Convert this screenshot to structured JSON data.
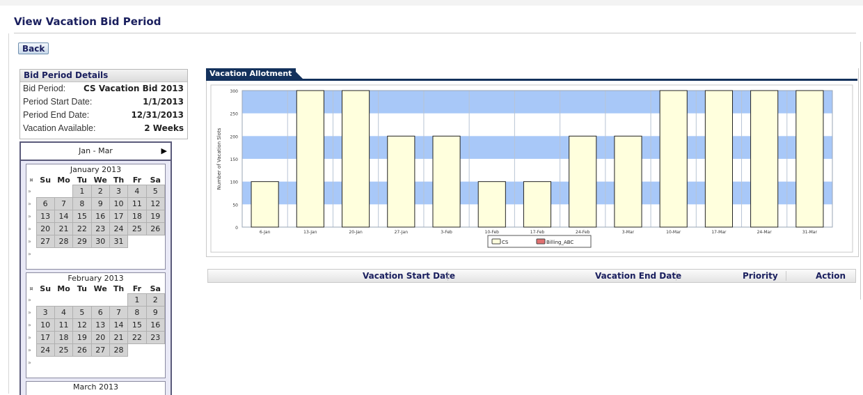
{
  "page": {
    "title": "View Vacation Bid Period",
    "back_label": "Back"
  },
  "details": {
    "heading": "Bid Period Details",
    "rows": [
      {
        "label": "Bid Period:",
        "value": "CS Vacation Bid 2013"
      },
      {
        "label": "Period Start Date:",
        "value": "1/1/2013"
      },
      {
        "label": "Period End Date:",
        "value": "12/31/2013"
      },
      {
        "label": "Vacation Available:",
        "value": "2 Weeks"
      }
    ]
  },
  "calendar": {
    "range_label": "Jan - Mar",
    "next_icon": "triangle-right-icon",
    "week_marker": "»",
    "weekdays": [
      "Su",
      "Mo",
      "Tu",
      "We",
      "Th",
      "Fr",
      "Sa"
    ],
    "months": [
      {
        "title": "January 2013",
        "weeks": [
          [
            "",
            "",
            "1",
            "2",
            "3",
            "4",
            "5"
          ],
          [
            "6",
            "7",
            "8",
            "9",
            "10",
            "11",
            "12"
          ],
          [
            "13",
            "14",
            "15",
            "16",
            "17",
            "18",
            "19"
          ],
          [
            "20",
            "21",
            "22",
            "23",
            "24",
            "25",
            "26"
          ],
          [
            "27",
            "28",
            "29",
            "30",
            "31",
            "",
            ""
          ],
          [
            "",
            "",
            "",
            "",
            "",
            "",
            ""
          ]
        ]
      },
      {
        "title": "February 2013",
        "weeks": [
          [
            "",
            "",
            "",
            "",
            "",
            "1",
            "2"
          ],
          [
            "3",
            "4",
            "5",
            "6",
            "7",
            "8",
            "9"
          ],
          [
            "10",
            "11",
            "12",
            "13",
            "14",
            "15",
            "16"
          ],
          [
            "17",
            "18",
            "19",
            "20",
            "21",
            "22",
            "23"
          ],
          [
            "24",
            "25",
            "26",
            "27",
            "28",
            "",
            ""
          ],
          [
            "",
            "",
            "",
            "",
            "",
            "",
            ""
          ]
        ]
      },
      {
        "title": "March 2013",
        "weeks": []
      }
    ]
  },
  "chart_tab": {
    "label": "Vacation Allotment"
  },
  "chart_data": {
    "type": "bar",
    "ylabel": "Number of Vacation Slots",
    "xlabel": "",
    "ylim": [
      0,
      300
    ],
    "yticks": [
      0,
      50,
      100,
      150,
      200,
      250,
      300
    ],
    "categories": [
      "6-Jan",
      "13-Jan",
      "20-Jan",
      "27-Jan",
      "3-Feb",
      "10-Feb",
      "17-Feb",
      "24-Feb",
      "3-Mar",
      "10-Mar",
      "17-Mar",
      "24-Mar",
      "31-Mar"
    ],
    "series": [
      {
        "name": "CS",
        "values": [
          100,
          300,
          300,
          200,
          200,
          100,
          100,
          200,
          200,
          300,
          300,
          300,
          300
        ],
        "color": "#ffffdd"
      },
      {
        "name": "Billing_ABC",
        "values": [
          0,
          0,
          0,
          0,
          0,
          0,
          0,
          0,
          0,
          0,
          0,
          0,
          0
        ],
        "color": "#e07070"
      }
    ],
    "band_color": "#a8c8f8",
    "grid": true,
    "legend": "bottom"
  },
  "grid": {
    "columns": [
      "Vacation Start Date",
      "Vacation End Date",
      "Priority",
      "Action"
    ]
  }
}
